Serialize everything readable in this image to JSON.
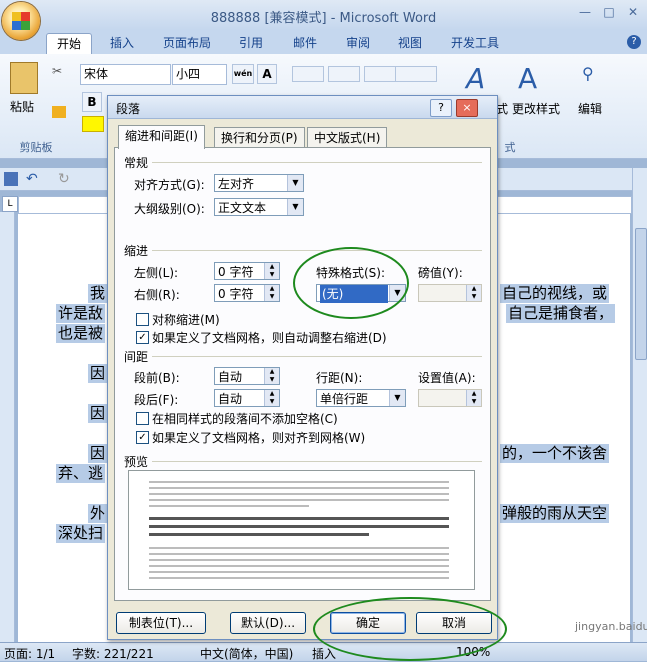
{
  "window": {
    "title": "888888 [兼容模式] - Microsoft Word",
    "help_label": "?"
  },
  "ribbon": {
    "tabs": [
      "开始",
      "插入",
      "页面布局",
      "引用",
      "邮件",
      "审阅",
      "视图",
      "开发工具"
    ],
    "clipboard": {
      "paste_label": "粘贴",
      "group_label": "剪贴板"
    },
    "font": {
      "name": "宋体",
      "size": "小四",
      "wen_label": "wén",
      "a_label": "A",
      "bold": "B"
    },
    "styles": {
      "change_label": "更改样式",
      "quick_label": "式",
      "group_label": "式"
    },
    "editing": {
      "label": "编辑"
    }
  },
  "status": {
    "page": "页面: 1/1",
    "words": "字数: 221/221",
    "lang": "中文(简体，中国)",
    "mode": "插入",
    "zoom": "100%"
  },
  "document": {
    "line1_left": "我",
    "line1_right": "自己的视线，或",
    "line2_left": "许是敌",
    "line2_right": "自己是捕食者，",
    "line3_left": "也是被",
    "line4": "因",
    "line5": "因",
    "line6_left": "因",
    "line6_right": "的，一个不该舍",
    "line7": "弃、逃",
    "line8_left": "外",
    "line8_right": "弹般的雨从天空",
    "line9": "深处扫"
  },
  "dialog": {
    "title": "段落",
    "help": "?",
    "close": "×",
    "tabs": [
      "缩进和间距(I)",
      "换行和分页(P)",
      "中文版式(H)"
    ],
    "general": {
      "heading": "常规",
      "alignment_label": "对齐方式(G):",
      "alignment_value": "左对齐",
      "outline_label": "大纲级别(O):",
      "outline_value": "正文文本"
    },
    "indent": {
      "heading": "缩进",
      "left_label": "左侧(L):",
      "left_value": "0 字符",
      "right_label": "右侧(R):",
      "right_value": "0 字符",
      "special_label": "特殊格式(S):",
      "special_value": "(无)",
      "by_label": "磅值(Y):",
      "mirror_label": "对称缩进(M)",
      "auto_right_label": "如果定义了文档网格，则自动调整右缩进(D)"
    },
    "spacing": {
      "heading": "间距",
      "before_label": "段前(B):",
      "before_value": "自动",
      "after_label": "段后(F):",
      "after_value": "自动",
      "line_label": "行距(N):",
      "line_value": "单倍行距",
      "at_label": "设置值(A):",
      "no_space_label": "在相同样式的段落间不添加空格(C)",
      "snap_grid_label": "如果定义了文档网格，则对齐到网格(W)"
    },
    "preview": {
      "heading": "预览"
    },
    "buttons": {
      "tabs": "制表位(T)...",
      "default": "默认(D)...",
      "ok": "确定",
      "cancel": "取消"
    }
  },
  "watermark": {
    "text": "jingyan.baidu.com"
  },
  "colors": {
    "highlight": "#b6cbe6",
    "annotation_circle": "#1e8a1e",
    "dialog_bg": "#ece9d8"
  }
}
